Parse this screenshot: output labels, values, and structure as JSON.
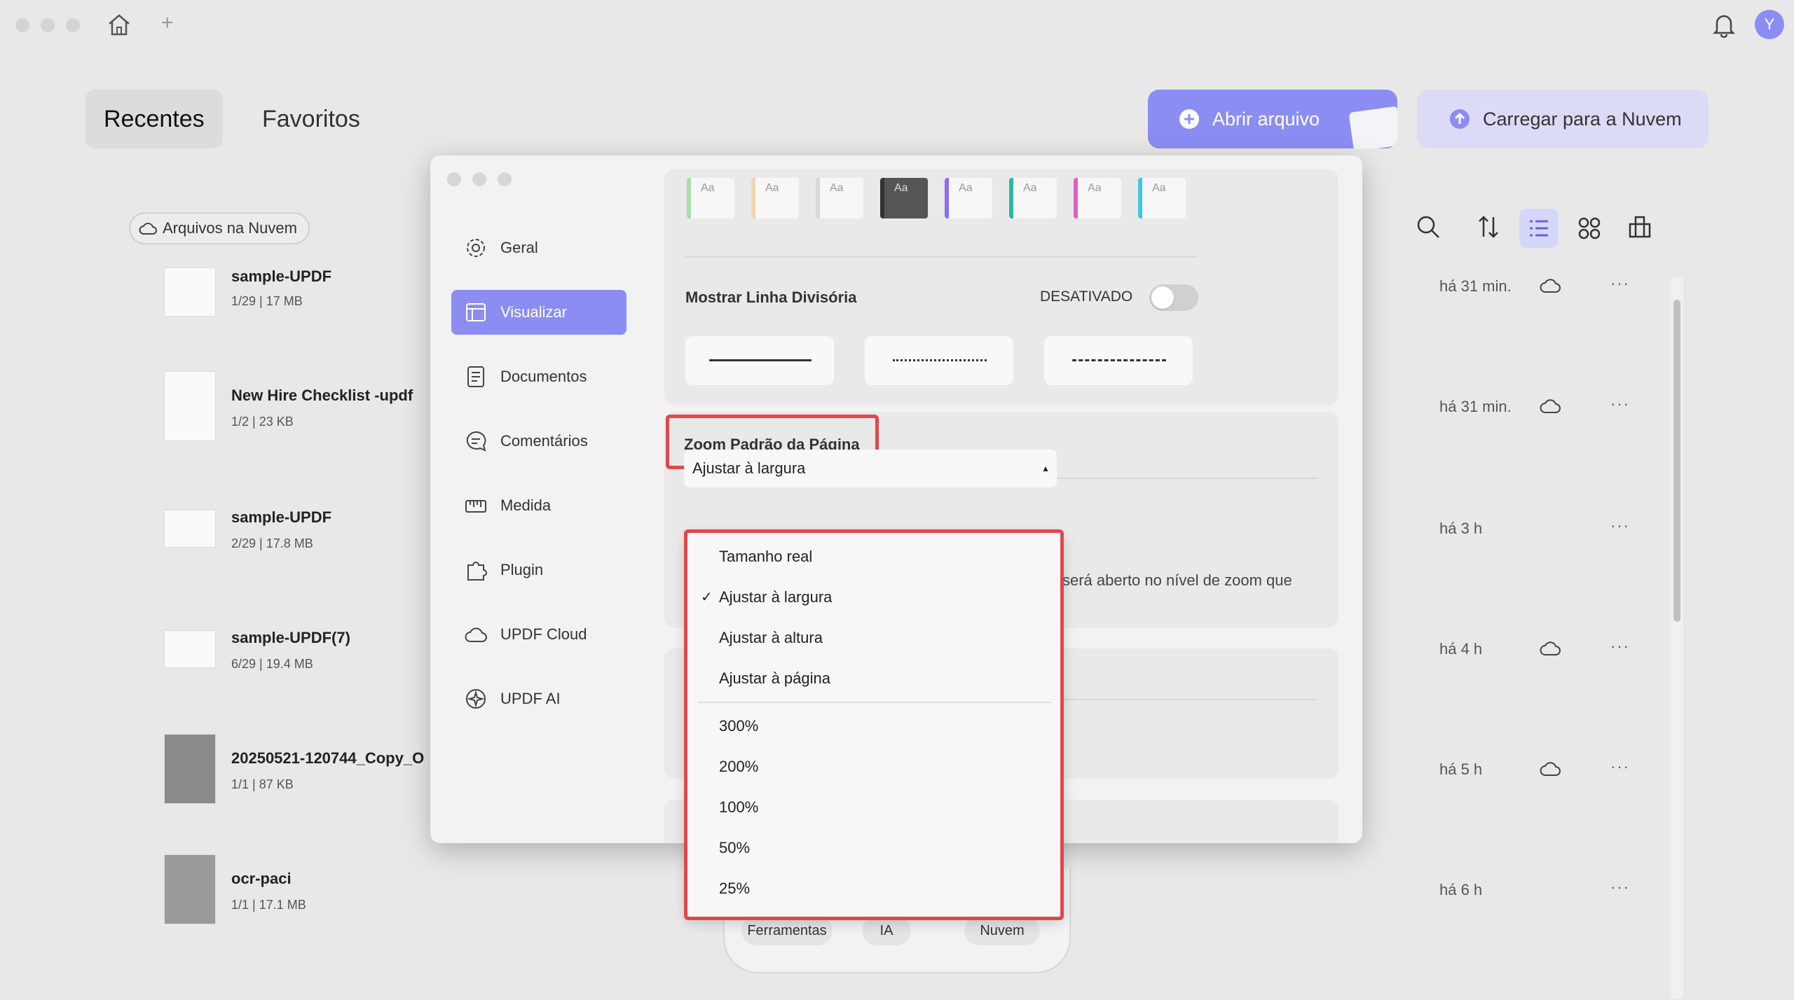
{
  "app": {
    "avatar_letter": "Y"
  },
  "header": {
    "tabs": [
      "Recentes",
      "Favoritos"
    ],
    "open_file": "Abrir arquivo",
    "upload_cloud": "Carregar para a Nuvem"
  },
  "cloud_files": "Arquivos na Nuvem",
  "files": [
    {
      "name": "sample-UPDF",
      "meta": "1/29 | 17 MB",
      "time": "há 31 min.",
      "cloud": true
    },
    {
      "name": "New Hire Checklist -updf",
      "meta": "1/2 | 23 KB",
      "time": "há 31 min.",
      "cloud": true
    },
    {
      "name": "sample-UPDF",
      "meta": "2/29 | 17.8 MB",
      "time": "há 3 h",
      "cloud": false
    },
    {
      "name": "sample-UPDF(7)",
      "meta": "6/29 | 19.4 MB",
      "time": "há 4 h",
      "cloud": true
    },
    {
      "name": "20250521-120744_Copy_O",
      "meta": "1/1 | 87 KB",
      "time": "há 5 h",
      "cloud": true
    },
    {
      "name": "ocr-paci",
      "meta": "1/1 | 17.1 MB",
      "time": "há 6 h",
      "cloud": false
    }
  ],
  "bottom_tabs": [
    "Ferramentas",
    "IA",
    "Nuvem"
  ],
  "settings": {
    "sidebar": [
      {
        "label": "Geral",
        "icon": "gear-icon"
      },
      {
        "label": "Visualizar",
        "icon": "layout-icon",
        "active": true
      },
      {
        "label": "Documentos",
        "icon": "document-icon"
      },
      {
        "label": "Comentários",
        "icon": "comment-icon"
      },
      {
        "label": "Medida",
        "icon": "ruler-icon"
      },
      {
        "label": "Plugin",
        "icon": "puzzle-icon"
      },
      {
        "label": "UPDF Cloud",
        "icon": "cloud-icon"
      },
      {
        "label": "UPDF AI",
        "icon": "ai-icon"
      }
    ],
    "show_divider_label": "Mostrar Linha Divisória",
    "show_divider_state": "DESATIVADO",
    "zoom_section_title": "Zoom Padrão da Página",
    "zoom_selected": "Ajustar à largura",
    "zoom_description_fragment": "será aberto no nível de zoom que",
    "zoom_options": [
      "Tamanho real",
      "Ajustar à largura",
      "Ajustar à altura",
      "Ajustar à página",
      "300%",
      "200%",
      "100%",
      "50%",
      "25%"
    ],
    "swatch_text": "Aa",
    "colors": {
      "accent": "#8c8df2",
      "highlight": "#e2474b"
    }
  }
}
